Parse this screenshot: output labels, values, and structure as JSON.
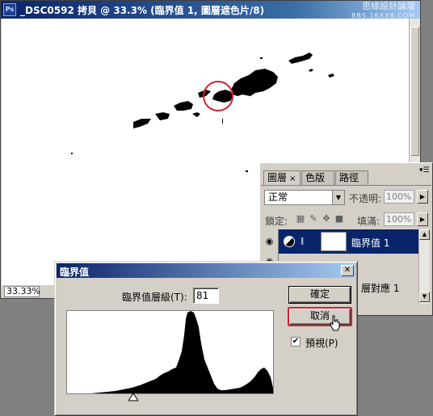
{
  "document": {
    "title": "_DSC0592 拷貝 @ 33.3% (臨界值 1, 圖層遮色片/8)",
    "zoom": "33.33%",
    "watermark_top": "思緣設計論壇",
    "watermark_bottom": "BBS.16XX8.COM"
  },
  "layers_panel": {
    "tabs": [
      {
        "label": "圖層",
        "active": true
      },
      {
        "label": "色版",
        "active": false
      },
      {
        "label": "路徑",
        "active": false
      }
    ],
    "blend_mode": "正常",
    "opacity_label": "不透明:",
    "opacity_value": "100%",
    "lock_label": "鎖定:",
    "fill_label": "填滿:",
    "fill_value": "100%",
    "layers": [
      {
        "name": "臨界值 1",
        "selected": true
      },
      {
        "name": "層對應 1",
        "selected": false
      }
    ]
  },
  "threshold_dialog": {
    "title": "臨界值",
    "level_label": "臨界值層級(T):",
    "level_value": "81",
    "ok_button": "確定",
    "cancel_button": "取消",
    "preview_label": "預視(P)",
    "preview_checked": true
  },
  "colors": {
    "title_active": "#0a246a",
    "highlight_red": "#d2202f",
    "face": "#d4d0c8"
  }
}
